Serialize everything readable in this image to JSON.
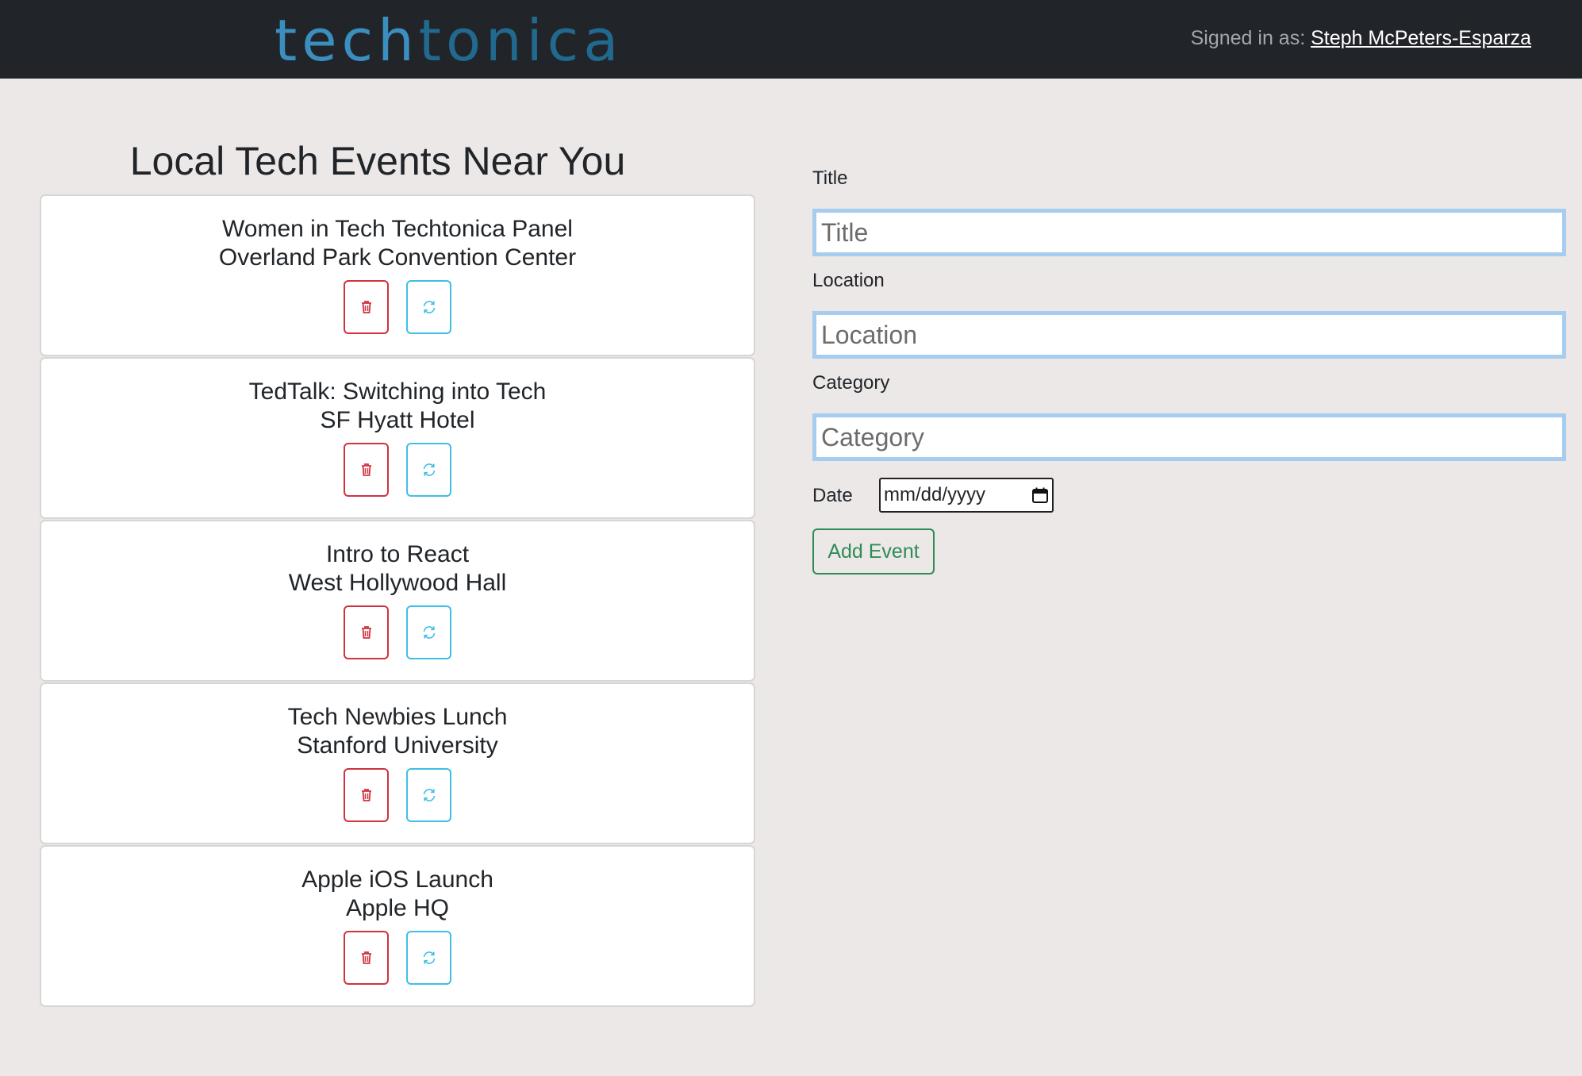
{
  "header": {
    "logo": {
      "part1": "tech",
      "part2": "tonica"
    },
    "signed_in_prefix": "Signed in as:",
    "user_name": "Steph McPeters-Esparza"
  },
  "main": {
    "heading": "Local Tech Events Near You",
    "events": [
      {
        "title": "Women in Tech Techtonica Panel",
        "location": "Overland Park Convention Center"
      },
      {
        "title": "TedTalk: Switching into Tech",
        "location": "SF Hyatt Hotel"
      },
      {
        "title": "Intro to React",
        "location": "West Hollywood Hall"
      },
      {
        "title": "Tech Newbies Lunch",
        "location": "Stanford University"
      },
      {
        "title": "Apple iOS Launch",
        "location": "Apple HQ"
      }
    ]
  },
  "form": {
    "title_label": "Title",
    "title_placeholder": "Title",
    "location_label": "Location",
    "location_placeholder": "Location",
    "category_label": "Category",
    "category_placeholder": "Category",
    "date_label": "Date",
    "date_placeholder": "mm/dd/yyyy",
    "submit_label": "Add Event"
  },
  "icons": {
    "delete": "trash-icon",
    "update": "refresh-icon",
    "calendar": "calendar-icon"
  },
  "colors": {
    "navbar": "#212529",
    "page_bg": "#ece8e7",
    "logo_light": "#3a8fbf",
    "logo_dark": "#21698f",
    "danger": "#d0333f",
    "info": "#3fbfe6",
    "success": "#2e8b57",
    "input_border": "#a6cdf0"
  }
}
